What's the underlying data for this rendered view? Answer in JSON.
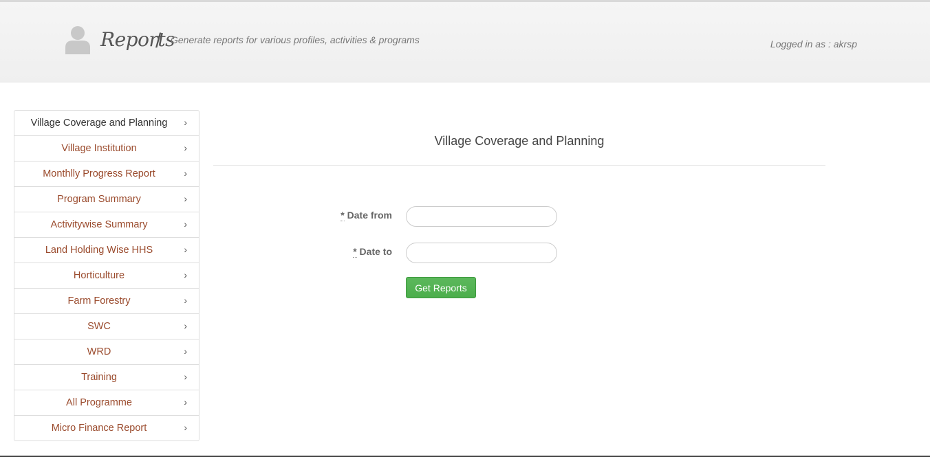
{
  "header": {
    "title": "Reports",
    "separator": "/",
    "subtitle": "Generate reports for various profiles, activities & programs",
    "logged_in": "Logged in as : akrsp"
  },
  "sidebar": {
    "items": [
      {
        "label": "Village Coverage and Planning",
        "active": true
      },
      {
        "label": "Village Institution"
      },
      {
        "label": "Monthlly Progress Report"
      },
      {
        "label": "Program Summary"
      },
      {
        "label": "Activitywise Summary"
      },
      {
        "label": "Land Holding Wise HHS"
      },
      {
        "label": "Horticulture"
      },
      {
        "label": "Farm Forestry"
      },
      {
        "label": "SWC"
      },
      {
        "label": "WRD"
      },
      {
        "label": "Training"
      },
      {
        "label": "All Programme"
      },
      {
        "label": "Micro Finance Report"
      }
    ]
  },
  "form": {
    "title": "Village Coverage and Planning",
    "required_marker": "*",
    "date_from_label": "Date from",
    "date_to_label": "Date to",
    "date_from_value": "",
    "date_to_value": "",
    "submit_label": "Get Reports"
  },
  "colors": {
    "link": "#9a4a2c",
    "button": "#5cb85c"
  },
  "icons": {
    "user": "user-icon",
    "chevron": "chevron-right-icon"
  }
}
